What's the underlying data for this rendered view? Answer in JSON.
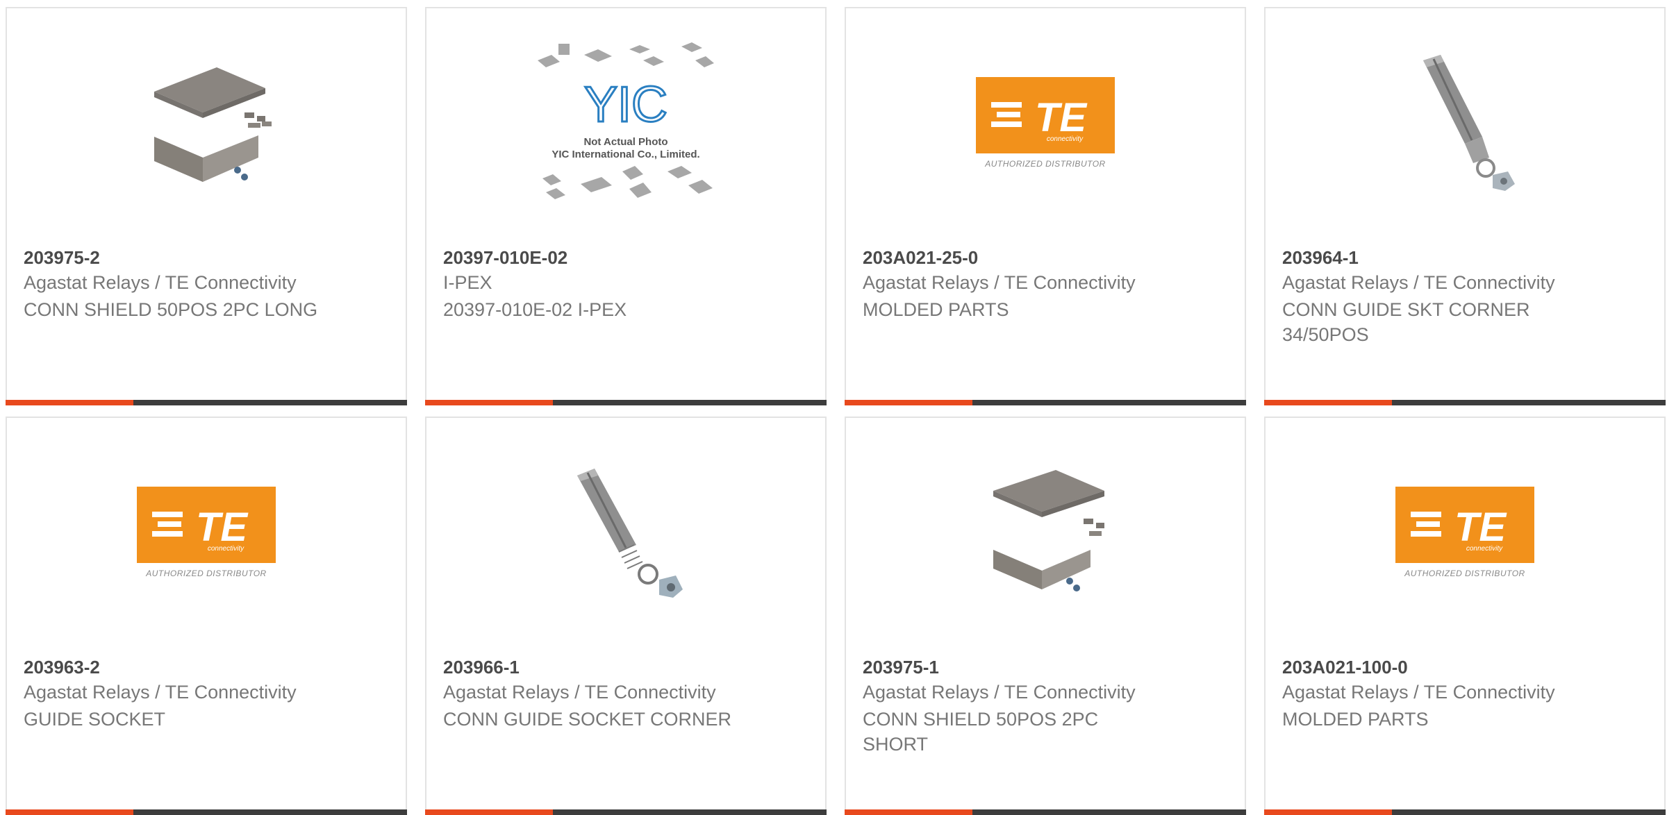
{
  "products": [
    {
      "part_number": "203975-2",
      "manufacturer": "Agastat Relays / TE Connectivity",
      "description": "CONN SHIELD 50POS 2PC LONG",
      "image": "shield-enclosure-image"
    },
    {
      "part_number": "20397-010E-02",
      "manufacturer": "I-PEX",
      "description": "20397-010E-02 I-PEX",
      "image": "yic-placeholder-image"
    },
    {
      "part_number": "203A021-25-0",
      "manufacturer": "Agastat Relays / TE Connectivity",
      "description": "MOLDED PARTS",
      "image": "te-logo-image"
    },
    {
      "part_number": "203964-1",
      "manufacturer": "Agastat Relays / TE Connectivity",
      "description": "CONN GUIDE SKT CORNER 34/50POS",
      "image": "guide-socket-image"
    },
    {
      "part_number": "203963-2",
      "manufacturer": "Agastat Relays / TE Connectivity",
      "description": "GUIDE SOCKET",
      "image": "te-logo-image"
    },
    {
      "part_number": "203966-1",
      "manufacturer": "Agastat Relays / TE Connectivity",
      "description": "CONN GUIDE SOCKET CORNER",
      "image": "guide-socket-image"
    },
    {
      "part_number": "203975-1",
      "manufacturer": "Agastat Relays / TE Connectivity",
      "description": "CONN SHIELD 50POS 2PC SHORT",
      "image": "shield-enclosure-image"
    },
    {
      "part_number": "203A021-100-0",
      "manufacturer": "Agastat Relays / TE Connectivity",
      "description": "MOLDED PARTS",
      "image": "te-logo-image"
    }
  ],
  "logo_text": {
    "te": "TE",
    "te_sub": "connectivity",
    "te_distributor": "AUTHORIZED DISTRIBUTOR",
    "yic": "YIC",
    "yic_line1": "Not Actual Photo",
    "yic_line2": "YIC International Co., Limited."
  },
  "colors": {
    "accent": "#e8491d",
    "bar": "#3d3d3d",
    "te_orange": "#f2911b",
    "text": "#777777",
    "title": "#4a4a4a"
  }
}
